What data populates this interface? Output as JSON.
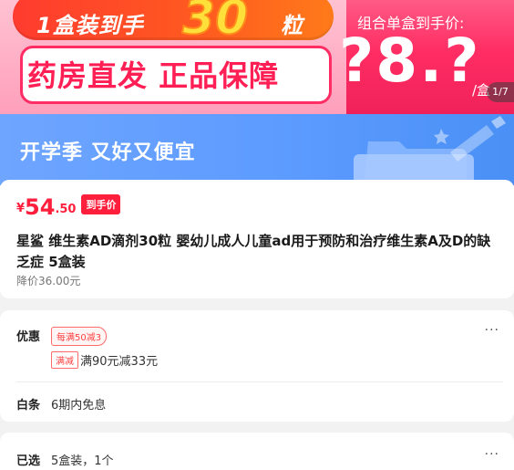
{
  "hero": {
    "pill_text": "1盒装到手",
    "pill_big": "30",
    "pill_tail": "粒",
    "box_text": "药房直发 正品保障",
    "right_label": "组合单盒到手价:",
    "price": "?8.?",
    "unit": "/盒",
    "page_indicator": "1/7"
  },
  "campaign": {
    "text": "开学季 又好又便宜"
  },
  "product": {
    "price_symbol": "¥",
    "price_int": "54",
    "price_dec": ".50",
    "price_tag": "到手价",
    "title": "星鲨 维生素AD滴剂30粒 婴幼儿成人儿童ad用于预防和治疗维生素A及D的缺乏症 5盒装",
    "price_sub": "降价36.00元"
  },
  "promo": {
    "label": "优惠",
    "coupon_tag": "每满50减3",
    "coupon_tag2": "满减",
    "coupon_desc": "满90元减33元",
    "more": "···"
  },
  "baitiao": {
    "label": "白条",
    "value": "6期内免息"
  },
  "selection": {
    "label": "已选",
    "value": "5盒装，1个",
    "more": "···"
  },
  "colors": {
    "accent_red": "#ff1f3d",
    "campaign_blue": "#5d9bff",
    "hero_pink": "#ff2d63"
  }
}
